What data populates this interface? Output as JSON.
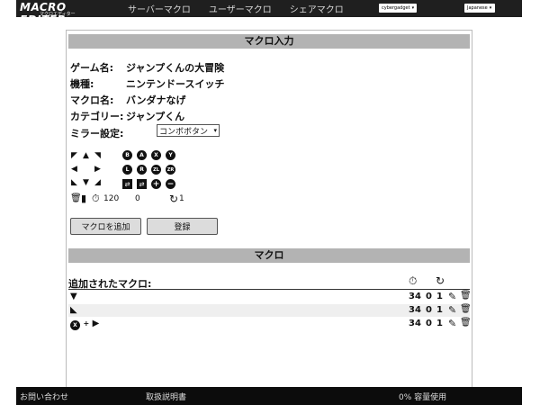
{
  "nav": {
    "logo_text": "MACRO EDITER",
    "logo_sub": "マクロエディター",
    "links": [
      "サーバーマクロ",
      "ユーザーマクロ",
      "シェアマクロ"
    ],
    "account_select": "cybergadget",
    "language_select": "Japanese"
  },
  "input_section": {
    "header": "マクロ入力",
    "game_label": "ゲーム名:",
    "game_value": "ジャンプくんの大冒険",
    "platform_label": "機種:",
    "platform_value": "ニンテンドースイッチ",
    "macro_name_label": "マクロ名:",
    "macro_name_value": "バンダナなげ",
    "category_label": "カテゴリー:",
    "category_value": "ジャンプくん",
    "mirror_label": "ミラー設定:",
    "mirror_value": "コンボボタン"
  },
  "buttons": {
    "face": [
      "B",
      "A",
      "X",
      "Y"
    ],
    "middle": [
      "L",
      "R",
      "ZL",
      "ZR"
    ],
    "plus": "+",
    "minus": "−"
  },
  "tools": {
    "timer_value": "120",
    "count_value": "0",
    "repeat_value": "1"
  },
  "actions": {
    "add_macro": "マクロを追加",
    "register": "登録"
  },
  "macro_section": {
    "header": "マクロ",
    "list_title": "追加されたマクロ:",
    "rows": [
      {
        "time": "34",
        "a": "0",
        "b": "1"
      },
      {
        "time": "34",
        "a": "0",
        "b": "1"
      },
      {
        "time": "34",
        "a": "0",
        "b": "1"
      }
    ],
    "row3_button": "X",
    "row3_plus": "+"
  },
  "footer": {
    "contact": "お問い合わせ",
    "manual": "取扱説明書",
    "usage": "0% 容量使用"
  },
  "colors": {
    "nav_bg": "#1f1f1f",
    "header_bg": "#b3b3b3",
    "footer_bg": "#0c0c0c"
  }
}
